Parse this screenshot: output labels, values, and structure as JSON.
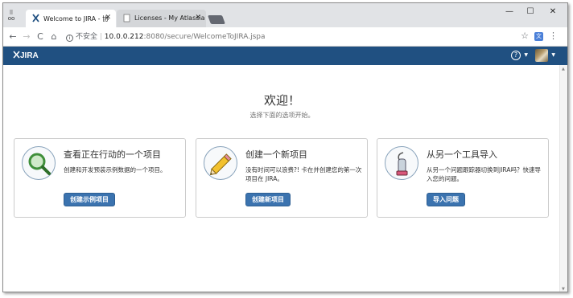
{
  "browser": {
    "tabs": [
      {
        "label": "Welcome to JIRA - 协",
        "active": true
      },
      {
        "label": "Licenses - My Atlassia",
        "active": false
      }
    ],
    "address": {
      "security_label": "不安全",
      "host": "10.0.0.212",
      "path": ":8080/secure/WelcomeToJIRA.jspa"
    },
    "window_controls": {
      "minimize": "—",
      "maximize": "☐",
      "close": "✕"
    }
  },
  "header": {
    "logo": "JIRA",
    "help_symbol": "?"
  },
  "welcome": {
    "title": "欢迎！",
    "subtitle": "选择下面的选项开始。"
  },
  "cards": [
    {
      "icon": "magnifier-icon",
      "title": "查看正在行动的一个项目",
      "description": "创建和开发预装示例数据的一个项目。",
      "button": "创建示例项目"
    },
    {
      "icon": "pencil-icon",
      "title": "创建一个新项目",
      "description": "没有时间可以浪费?! 卡在并创建您的第一次项目在 JIRA。",
      "button": "创建新项目"
    },
    {
      "icon": "vacuum-icon",
      "title": "从另一个工具导入",
      "description": "从另一个问题跟踪器切换到JIRA吗？快速导入您的问题。",
      "button": "导入问题"
    }
  ],
  "colors": {
    "jira_header": "#205081",
    "button": "#3b73af"
  }
}
